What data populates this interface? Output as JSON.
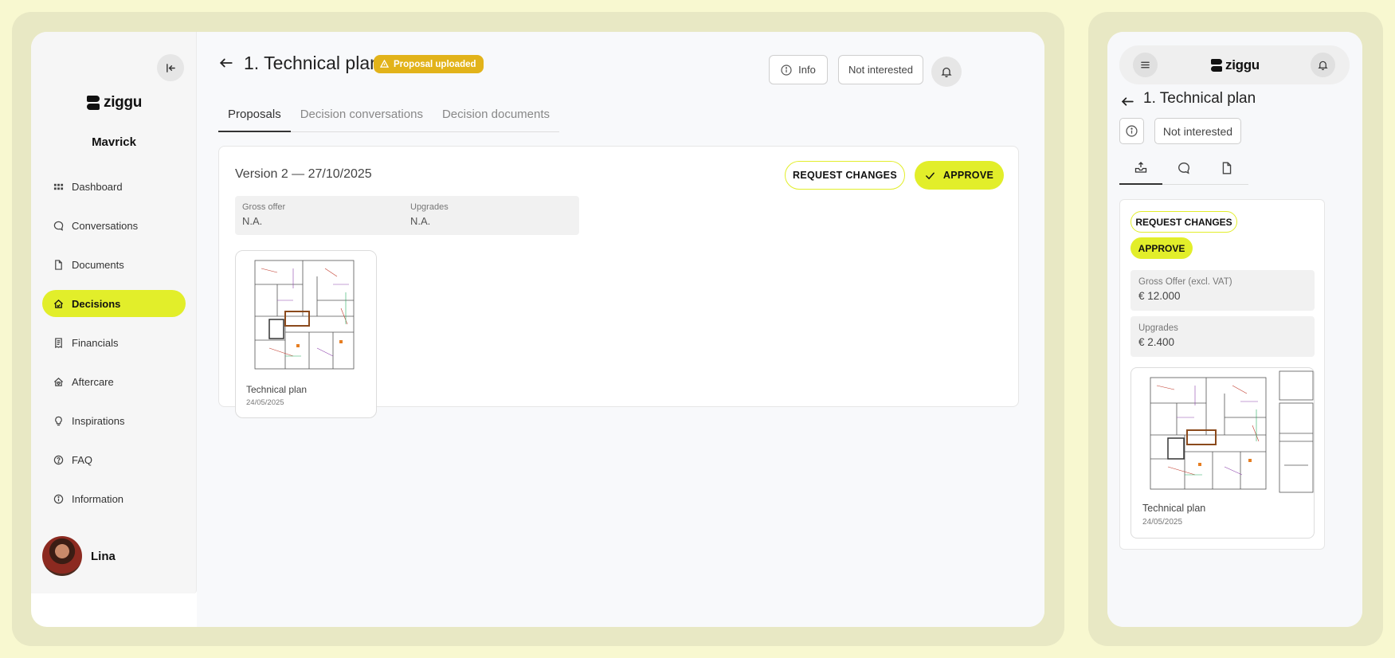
{
  "sidebar": {
    "brand": "ziggu",
    "project": "Mavrick",
    "items": [
      {
        "label": "Dashboard",
        "icon": "grid-icon",
        "active": false
      },
      {
        "label": "Conversations",
        "icon": "chat-icon",
        "active": false
      },
      {
        "label": "Documents",
        "icon": "file-icon",
        "active": false
      },
      {
        "label": "Decisions",
        "icon": "home-check-icon",
        "active": true
      },
      {
        "label": "Financials",
        "icon": "receipt-icon",
        "active": false
      },
      {
        "label": "Aftercare",
        "icon": "house-heart-icon",
        "active": false
      },
      {
        "label": "Inspirations",
        "icon": "bulb-icon",
        "active": false
      },
      {
        "label": "FAQ",
        "icon": "question-icon",
        "active": false
      },
      {
        "label": "Information",
        "icon": "info-icon",
        "active": false
      }
    ],
    "user": {
      "name": "Lina"
    }
  },
  "header": {
    "title": "1. Technical plan",
    "badge": "Proposal uploaded",
    "info_label": "Info",
    "not_interested_label": "Not interested"
  },
  "tabs": [
    {
      "label": "Proposals",
      "active": true
    },
    {
      "label": "Decision conversations",
      "active": false
    },
    {
      "label": "Decision documents",
      "active": false
    }
  ],
  "proposal": {
    "version": "Version 2 — 27/10/2025",
    "request_changes_label": "REQUEST CHANGES",
    "approve_label": "APPROVE",
    "fields": [
      {
        "label": "Gross offer",
        "value": "N.A."
      },
      {
        "label": "Upgrades",
        "value": "N.A."
      }
    ],
    "document": {
      "name": "Technical plan",
      "date": "24/05/2025"
    }
  },
  "mobile": {
    "brand": "ziggu",
    "title": "1. Technical plan",
    "not_interested_label": "Not interested",
    "tabs": [
      {
        "icon": "inbox-upload-icon",
        "active": true
      },
      {
        "icon": "chat-icon",
        "active": false
      },
      {
        "icon": "file-icon",
        "active": false
      }
    ],
    "request_changes_label": "REQUEST CHANGES",
    "approve_label": "APPROVE",
    "fields": [
      {
        "label": "Gross Offer (excl. VAT)",
        "value": "€ 12.000"
      },
      {
        "label": "Upgrades",
        "value": "€ 2.400"
      }
    ],
    "document": {
      "name": "Technical plan",
      "date": "24/05/2025"
    }
  },
  "colors": {
    "accent": "#e2ee2a",
    "badge": "#e2b31a",
    "frame": "#e8e8c4",
    "background": "#f8f8d0"
  }
}
